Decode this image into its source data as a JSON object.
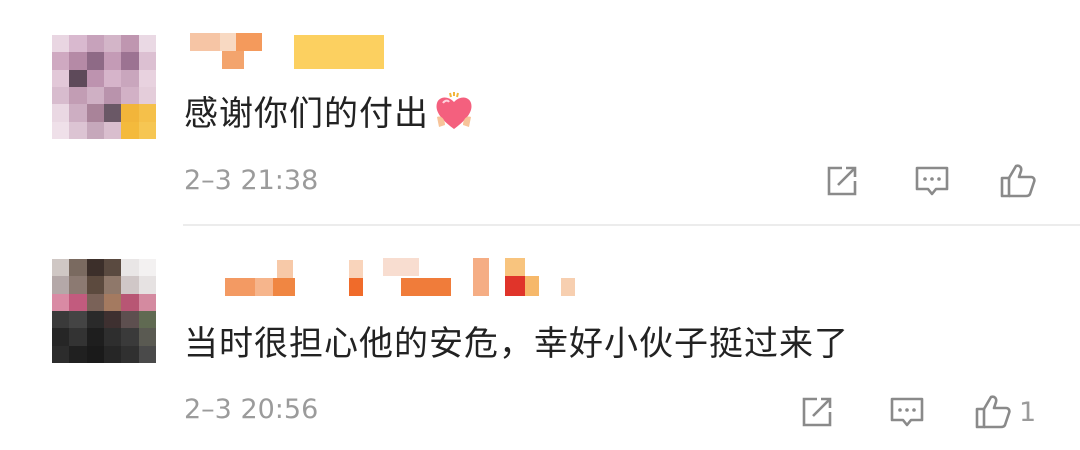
{
  "comments": [
    {
      "text": "感谢你们的付出",
      "emoji": "heart-emoji",
      "time": "2–3 21:38",
      "like_count": ""
    },
    {
      "text": "当时很担心他的安危，幸好小伙子挺过来了",
      "emoji": "",
      "time": "2–3 20:56",
      "like_count": "1"
    }
  ],
  "icons": {
    "share": "share-icon",
    "reply": "comment-icon",
    "like": "like-icon"
  },
  "colors": {
    "text": "#222222",
    "meta": "#9b9b9b",
    "divider": "#ececec",
    "username_blur": "#f08a3c"
  }
}
